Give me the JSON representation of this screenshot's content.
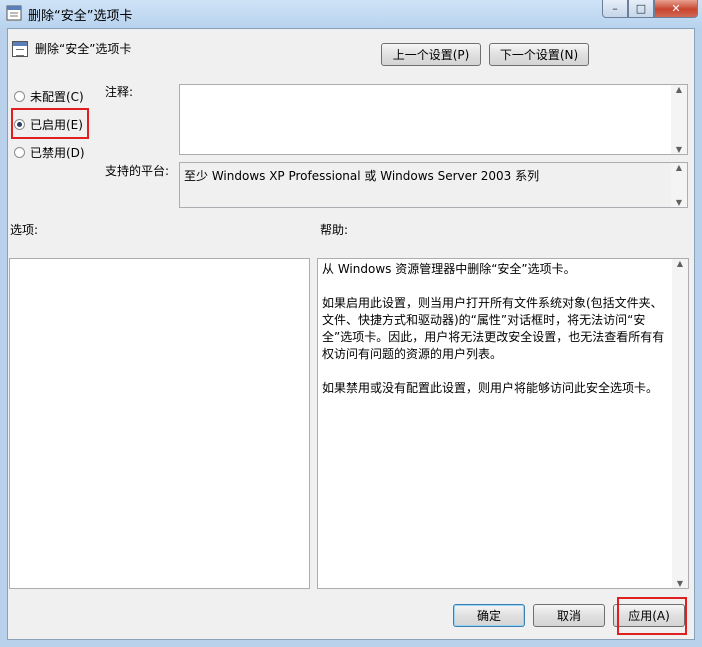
{
  "window": {
    "title": "删除“安全”选项卡",
    "icon": "policy-icon",
    "controls": {
      "minimize": "–",
      "maximize": "□",
      "close": "✕"
    }
  },
  "header": {
    "title": "删除“安全”选项卡",
    "prev_button": "上一个设置(P)",
    "next_button": "下一个设置(N)"
  },
  "state": {
    "options": [
      {
        "label": "未配置(C)",
        "selected": false
      },
      {
        "label": "已启用(E)",
        "selected": true
      },
      {
        "label": "已禁用(D)",
        "selected": false
      }
    ]
  },
  "comment": {
    "label": "注释:",
    "value": ""
  },
  "platform": {
    "label": "支持的平台:",
    "value": "至少 Windows XP Professional 或 Windows Server 2003 系列"
  },
  "options_pane": {
    "label": "选项:"
  },
  "help_pane": {
    "label": "帮助:",
    "text": "从 Windows 资源管理器中删除“安全”选项卡。\n\n如果启用此设置，则当用户打开所有文件系统对象(包括文件夹、文件、快捷方式和驱动器)的“属性”对话框时，将无法访问“安全”选项卡。因此，用户将无法更改安全设置，也无法查看所有有权访问有问题的资源的用户列表。\n\n如果禁用或没有配置此设置，则用户将能够访问此安全选项卡。"
  },
  "footer": {
    "ok": "确定",
    "cancel": "取消",
    "apply": "应用(A)"
  },
  "colors": {
    "highlight": "#e02020",
    "window_frame": "#b9d1ea",
    "client": "#f0f0f0"
  }
}
